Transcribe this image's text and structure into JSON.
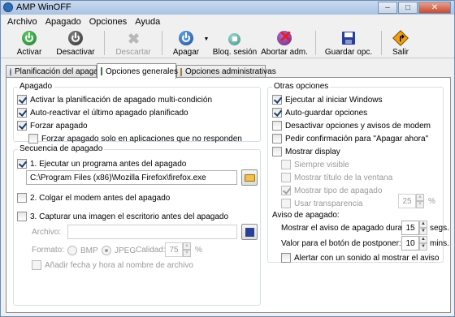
{
  "window": {
    "title": "AMP WinOFF"
  },
  "menu": [
    "Archivo",
    "Apagado",
    "Opciones",
    "Ayuda"
  ],
  "toolbar": {
    "activar": "Activar",
    "desactivar": "Desactivar",
    "descartar": "Descartar",
    "apagar": "Apagar",
    "bloq_sesion": "Bloq. sesión",
    "abortar": "Abortar adm.",
    "guardar": "Guardar opc.",
    "salir": "Salir"
  },
  "tabs": [
    "Planificación del apagado",
    "Opciones generales",
    "Opciones administrativas"
  ],
  "apagado": {
    "title": "Apagado",
    "activar_multi": "Activar la planificación de apagado multi-condición",
    "auto_reactivar": "Auto-reactivar el último apagado planificado",
    "forzar": "Forzar apagado",
    "forzar_no_responden": "Forzar apagado solo en aplicaciones que no responden"
  },
  "secuencia": {
    "title": "Secuencia de apagado",
    "ejecutar": "1. Ejecutar un programa antes del apagado",
    "program_path": "C:\\Program Files (x86)\\Mozilla Firefox\\firefox.exe",
    "colgar": "2. Colgar el modem antes del apagado",
    "capturar": "3. Capturar una imagen el escritorio antes del apagado",
    "archivo_label": "Archivo:",
    "archivo_value": "",
    "formato_label": "Formato:",
    "bmp": "BMP",
    "jpeg": "JPEG",
    "calidad_label": "Calidad:",
    "calidad_value": "75",
    "calidad_unit": "%",
    "anadir_fecha": "Añadir fecha y hora al nombre de archivo"
  },
  "otras": {
    "title": "Otras opciones",
    "ejecutar_windows": "Ejecutar al iniciar Windows",
    "auto_guardar": "Auto-guardar opciones",
    "desactivar_avisos": "Desactivar opciones y avisos de modem",
    "pedir_confirmacion": "Pedir confirmación para \"Apagar ahora\"",
    "mostrar_display": "Mostrar display",
    "siempre_visible": "Siempre visible",
    "mostrar_titulo": "Mostrar título de la ventana",
    "mostrar_tipo": "Mostrar tipo de apagado",
    "usar_transparencia": "Usar transparencia",
    "transparencia_value": "25",
    "transparencia_unit": "%"
  },
  "aviso": {
    "title": "Aviso de apagado:",
    "mostrar_durante_label": "Mostrar el aviso de apagado durante:",
    "mostrar_durante_value": "15",
    "mostrar_durante_unit": "segs.",
    "postponer_label": "Valor para el botón de postponer:",
    "postponer_value": "10",
    "postponer_unit": "mins.",
    "alertar_sonido": "Alertar con un sonido al mostrar el aviso"
  }
}
